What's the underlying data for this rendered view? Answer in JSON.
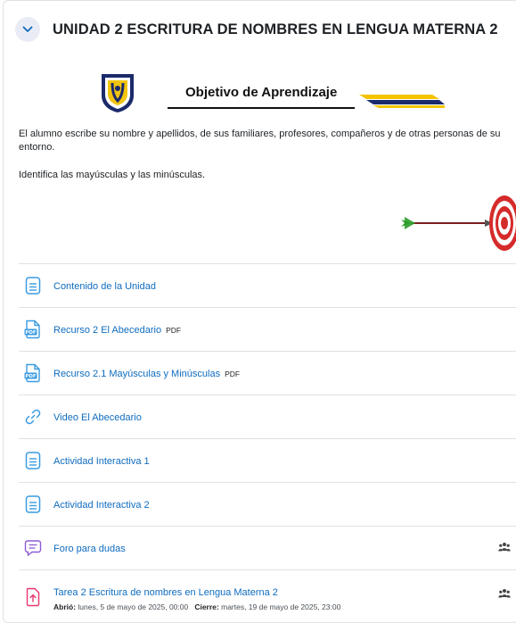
{
  "section": {
    "title": "UNIDAD 2 ESCRITURA DE NOMBRES EN LENGUA MATERNA 2"
  },
  "objective": {
    "banner_title": "Objetivo de Aprendizaje",
    "paragraph1": "El alumno escribe su nombre y apellidos, de sus familiares, profesores, compañeros y de otras personas de su entorno.",
    "paragraph2": "Identifica las mayúsculas y las minúsculas."
  },
  "colors": {
    "link": "#0f6cbf",
    "page_icon": "#399be2",
    "forum_icon": "#8c5bd6",
    "assign_icon": "#e7356b",
    "header_toggle_bg": "#e9ecf5"
  },
  "activities": [
    {
      "label": "Contenido de la Unidad",
      "icon": "page-icon",
      "badge": ""
    },
    {
      "label": "Recurso 2 El Abecedario",
      "icon": "pdf-icon",
      "badge": "PDF"
    },
    {
      "label": "Recurso 2.1 Mayúsculas y Minúsculas",
      "icon": "pdf-icon",
      "badge": "PDF"
    },
    {
      "label": "Video El Abecedario",
      "icon": "link-icon",
      "badge": ""
    },
    {
      "label": "Actividad Interactiva 1",
      "icon": "page-icon",
      "badge": ""
    },
    {
      "label": "Actividad Interactiva 2",
      "icon": "page-icon",
      "badge": ""
    },
    {
      "label": "Foro para dudas",
      "icon": "forum-icon",
      "badge": "",
      "group_icon": "group-icon"
    },
    {
      "label": "Tarea 2 Escritura de nombres en Lengua Materna 2",
      "icon": "assign-icon",
      "badge": "",
      "group_icon": "group-icon",
      "opened_label": "Abrió:",
      "opened_value": "lunes, 5 de mayo de 2025, 00:00",
      "closes_label": "Cierre:",
      "closes_value": "martes, 19 de mayo de 2025, 23:00"
    }
  ]
}
